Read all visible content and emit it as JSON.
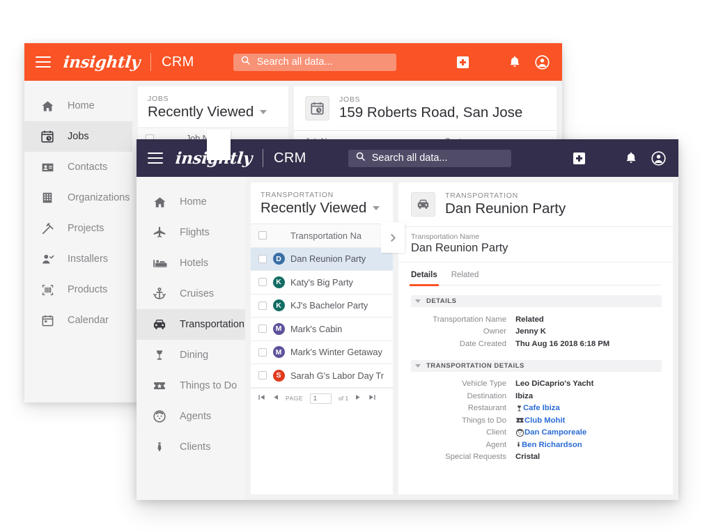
{
  "back_window": {
    "header": {
      "logo": "insightly",
      "product": "CRM",
      "search_placeholder": "Search all data...",
      "menu_icon": "hamburger-icon",
      "add_icon": "plus-icon",
      "apps_icon": "app-grid-icon",
      "notifications_icon": "bell-icon",
      "profile_icon": "user-avatar-icon",
      "bg_color": "#FA5325",
      "search_bg_color": "#F89277"
    },
    "sidebar": {
      "items": [
        {
          "label": "Home",
          "icon": "home-icon",
          "active": false
        },
        {
          "label": "Jobs",
          "icon": "job-calendar-clock-icon",
          "active": true
        },
        {
          "label": "Contacts",
          "icon": "contact-card-icon",
          "active": false
        },
        {
          "label": "Organizations",
          "icon": "building-icon",
          "active": false
        },
        {
          "label": "Projects",
          "icon": "hammer-icon",
          "active": false
        },
        {
          "label": "Installers",
          "icon": "person-check-icon",
          "active": false
        },
        {
          "label": "Products",
          "icon": "barcode-icon",
          "active": false
        },
        {
          "label": "Calendar",
          "icon": "calendar-icon",
          "active": false
        }
      ]
    },
    "list_panel": {
      "eyebrow": "JOBS",
      "title": "Recently Viewed",
      "dropdown_icon": "chevron-down-icon",
      "column_header": "Job Name"
    },
    "detail_panel": {
      "eyebrow": "JOBS",
      "title": "159 Roberts Road, San Jose",
      "record_icon": "job-calendar-clock-icon",
      "columns": [
        "Job Name",
        "Customer"
      ]
    }
  },
  "front_window": {
    "header": {
      "logo": "insightly",
      "product": "CRM",
      "search_placeholder": "Search all data...",
      "menu_icon": "hamburger-icon",
      "add_icon": "plus-icon",
      "apps_icon": "app-grid-icon",
      "notifications_icon": "bell-icon",
      "profile_icon": "user-avatar-icon",
      "bg_color": "#322E4B",
      "search_bg_color": "#504C68"
    },
    "sidebar": {
      "items": [
        {
          "label": "Home",
          "icon": "home-icon",
          "active": false
        },
        {
          "label": "Flights",
          "icon": "airplane-icon",
          "active": false
        },
        {
          "label": "Hotels",
          "icon": "bed-icon",
          "active": false
        },
        {
          "label": "Cruises",
          "icon": "anchor-icon",
          "active": false
        },
        {
          "label": "Transportation",
          "icon": "car-icon",
          "active": true
        },
        {
          "label": "Dining",
          "icon": "wine-glass-icon",
          "active": false
        },
        {
          "label": "Things to Do",
          "icon": "ticket-star-icon",
          "active": false
        },
        {
          "label": "Agents",
          "icon": "smiley-face-icon",
          "active": false
        },
        {
          "label": "Clients",
          "icon": "necktie-icon",
          "active": false
        }
      ]
    },
    "list_panel": {
      "eyebrow": "TRANSPORTATION",
      "title": "Recently Viewed",
      "dropdown_icon": "chevron-down-icon",
      "column_header": "Transportation Na",
      "expand_icon": "chevron-right-icon",
      "rows": [
        {
          "initial": "D",
          "color": "#3A6EA5",
          "name": "Dan Reunion Party",
          "selected": true
        },
        {
          "initial": "K",
          "color": "#136D64",
          "name": "Katy's Big Party",
          "selected": false
        },
        {
          "initial": "K",
          "color": "#136D64",
          "name": "KJ's Bachelor Party",
          "selected": false
        },
        {
          "initial": "M",
          "color": "#5E529B",
          "name": "Mark's Cabin",
          "selected": false
        },
        {
          "initial": "M",
          "color": "#5E529B",
          "name": "Mark's Winter Getaway",
          "selected": false
        },
        {
          "initial": "S",
          "color": "#E03A1E",
          "name": "Sarah G's Labor Day Tr",
          "selected": false
        }
      ],
      "pager": {
        "first_icon": "page-first-icon",
        "prev_icon": "page-prev-icon",
        "label": "PAGE",
        "page_value": "1",
        "of_text": "of 1",
        "next_icon": "page-next-icon",
        "last_icon": "page-last-icon"
      }
    },
    "detail_panel": {
      "eyebrow": "TRANSPORTATION",
      "title": "Dan Reunion Party",
      "record_icon": "car-icon",
      "name_field": {
        "label": "Transportation Name",
        "value": "Dan Reunion Party"
      },
      "tabs": [
        {
          "label": "Details",
          "active": true
        },
        {
          "label": "Related",
          "active": false
        }
      ],
      "sections": [
        {
          "title": "DETAILS",
          "collapse_icon": "chevron-down-icon",
          "fields": [
            {
              "label": "Transportation Name",
              "value": "Related",
              "link": false,
              "icon": null
            },
            {
              "label": "Owner",
              "value": "Jenny K",
              "link": false,
              "icon": null
            },
            {
              "label": "Date Created",
              "value": "Thu Aug 16 2018 6:18 PM",
              "link": false,
              "icon": null
            }
          ]
        },
        {
          "title": "TRANSPORTATION DETAILS",
          "collapse_icon": "chevron-down-icon",
          "fields": [
            {
              "label": "Vehicle Type",
              "value": "Leo DiCaprio's Yacht",
              "link": false,
              "icon": null
            },
            {
              "label": "Destination",
              "value": "Ibiza",
              "link": false,
              "icon": null
            },
            {
              "label": "Restaurant",
              "value": "Cafe Ibiza",
              "link": true,
              "icon": "wine-glass-icon"
            },
            {
              "label": "Things to Do",
              "value": "Club Mohit",
              "link": true,
              "icon": "ticket-star-icon"
            },
            {
              "label": "Client",
              "value": "Dan Camporeale",
              "link": true,
              "icon": "smiley-face-icon"
            },
            {
              "label": "Agent",
              "value": "Ben Richardson",
              "link": true,
              "icon": "necktie-icon"
            },
            {
              "label": "Special Requests",
              "value": "Cristal",
              "link": false,
              "icon": null
            }
          ]
        }
      ],
      "link_color": "#2B6CD4"
    }
  }
}
